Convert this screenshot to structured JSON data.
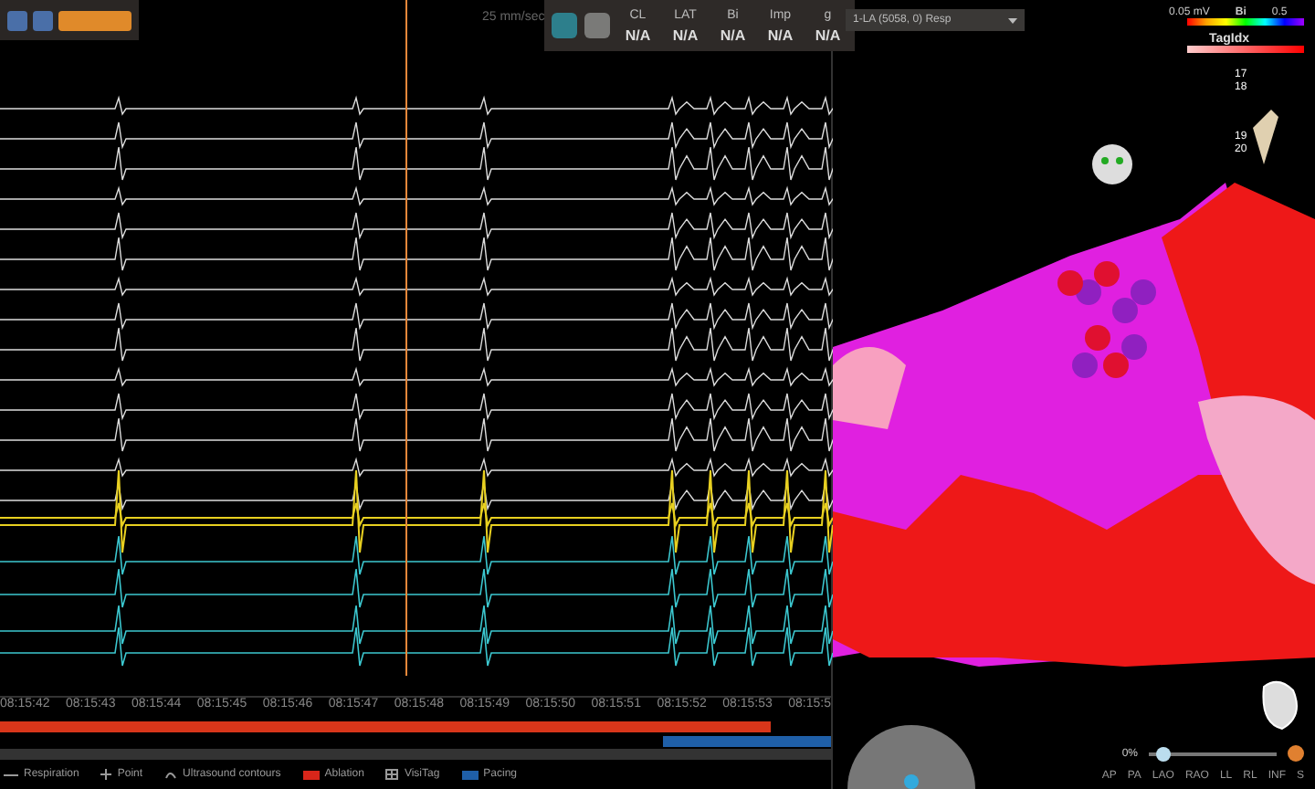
{
  "toolbar": {
    "speed": "25 mm/sec"
  },
  "readouts": [
    {
      "label": "CL",
      "value": "N/A"
    },
    {
      "label": "LAT",
      "value": "N/A"
    },
    {
      "label": "Bi",
      "value": "N/A"
    },
    {
      "label": "Imp",
      "value": "N/A"
    },
    {
      "label": "g",
      "value": "N/A"
    }
  ],
  "timeline": {
    "ticks": [
      "08:15:42",
      "08:15:43",
      "08:15:44",
      "08:15:45",
      "08:15:46",
      "08:15:47",
      "08:15:48",
      "08:15:49",
      "08:15:50",
      "08:15:51",
      "08:15:52",
      "08:15:53",
      "08:15:5"
    ]
  },
  "legend": [
    {
      "label": "Respiration",
      "kind": "line"
    },
    {
      "label": "Point",
      "kind": "plus"
    },
    {
      "label": "Ultrasound contours",
      "kind": "contour"
    },
    {
      "label": "Ablation",
      "kind": "swatch",
      "color": "#d8261a"
    },
    {
      "label": "VisiTag",
      "kind": "grid"
    },
    {
      "label": "Pacing",
      "kind": "swatch",
      "color": "#1f5fa8"
    }
  ],
  "map": {
    "dropdown": "1-LA (5058, 0) Resp",
    "scale": {
      "min": "0.05 mV",
      "name": "Bi",
      "max": "0.5"
    },
    "tag_legend": "TagIdx",
    "tags": [
      "17",
      "18",
      "19",
      "20"
    ],
    "opacity": {
      "reading": "0%",
      "level": 0.12
    },
    "views": [
      "AP",
      "PA",
      "LAO",
      "RAO",
      "LL",
      "RL",
      "INF",
      "S"
    ]
  }
}
